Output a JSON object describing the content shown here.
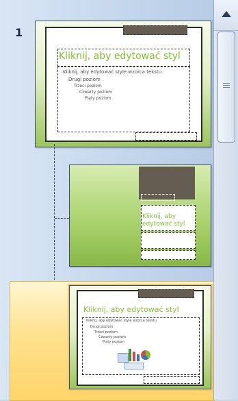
{
  "panel": {
    "slides": [
      {
        "number": "1",
        "title": "Kliknij, aby edytować styl",
        "bullets": [
          "Kliknij, aby edytować style wzorca tekstu",
          "Drugi poziom",
          "Trzeci poziom",
          "Czwarty poziom",
          "Piąty poziom"
        ]
      },
      {
        "title": "Kliknij, aby edytować styl"
      },
      {
        "title": "Kliknij, aby edytować styl",
        "bullets": [
          "Kliknij, aby edytować style wzorca tekstu",
          "Drugi poziom",
          "Trzeci poziom",
          "Czwarty poziom",
          "Piąty poziom"
        ]
      }
    ]
  },
  "scrollbar": {
    "up_icon": "chevron-up-icon",
    "grip_icon": "grip-lines-icon"
  }
}
